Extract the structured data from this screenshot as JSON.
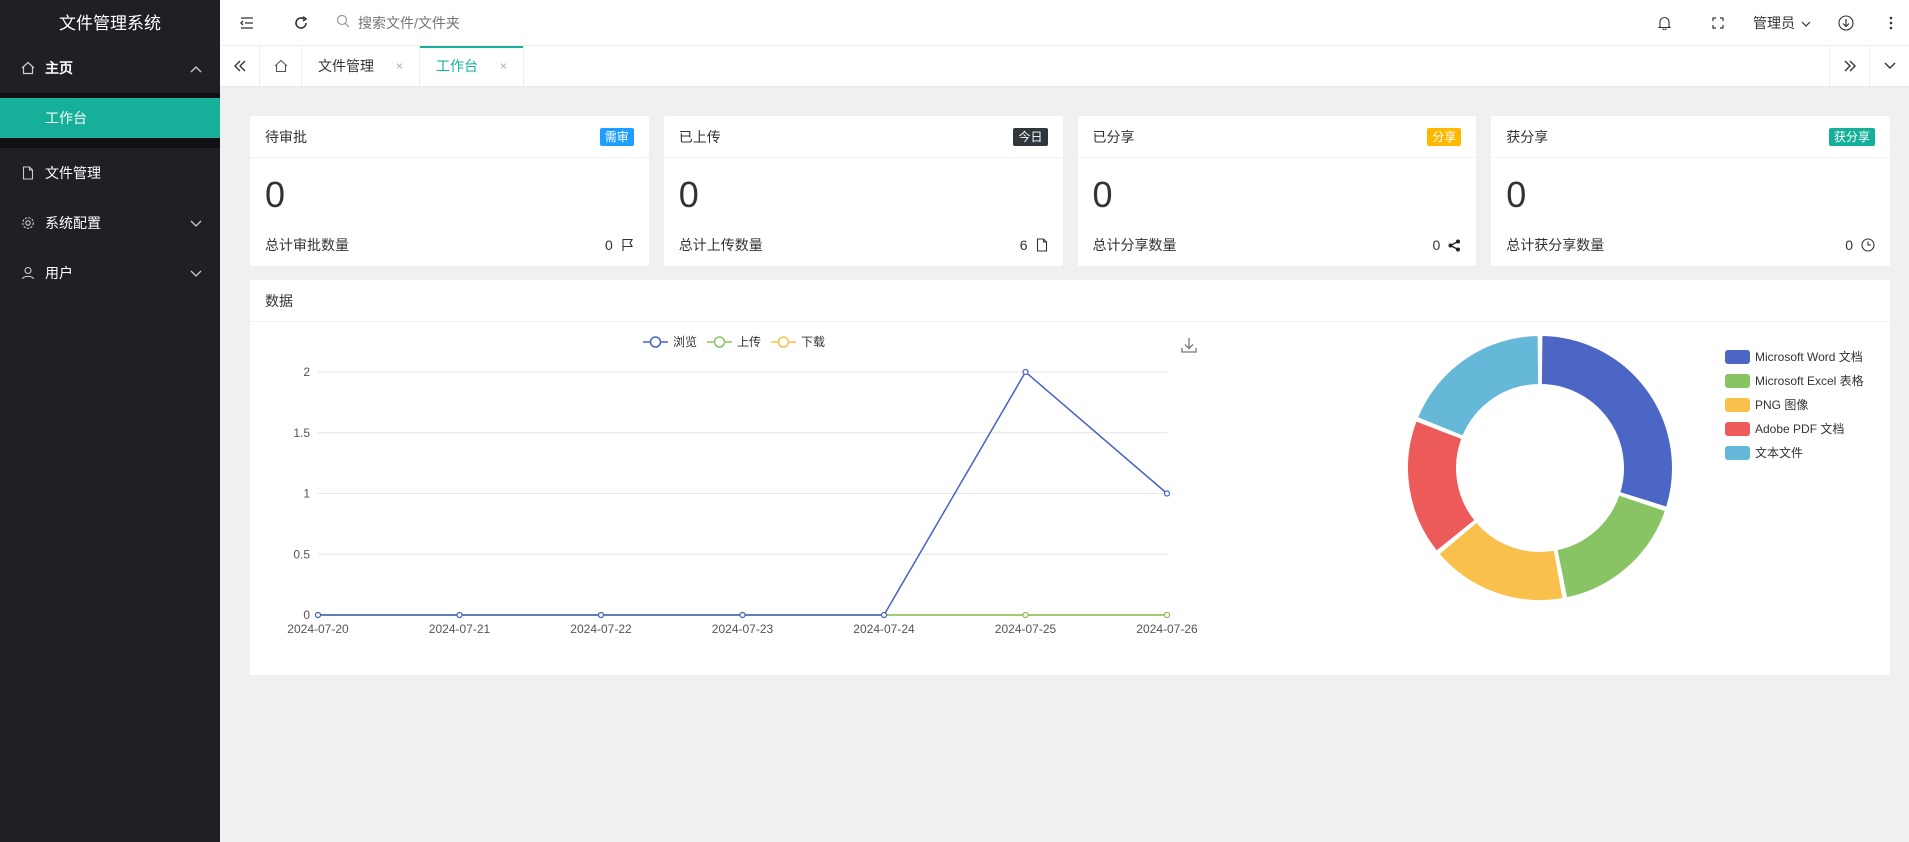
{
  "sidebar": {
    "brand": "文件管理系统",
    "items": [
      {
        "label": "主页",
        "icon": "home-icon",
        "expanded": true
      },
      {
        "label": "工作台",
        "active": true
      },
      {
        "label": "文件管理",
        "icon": "file-icon"
      },
      {
        "label": "系统配置",
        "icon": "gear-icon"
      },
      {
        "label": "用户",
        "icon": "user-icon"
      }
    ]
  },
  "header": {
    "search_placeholder": "搜索文件/文件夹",
    "user": "管理员"
  },
  "tabs": {
    "items": [
      {
        "label": "文件管理",
        "close": "×"
      },
      {
        "label": "工作台",
        "close": "×",
        "active": true
      }
    ]
  },
  "cards": [
    {
      "title": "待审批",
      "badge": "需审",
      "badge_color": "#1e9fff",
      "value": "0",
      "footer_label": "总计审批数量",
      "footer_value": "0",
      "icon": "flag-icon"
    },
    {
      "title": "已上传",
      "badge": "今日",
      "badge_color": "#2f363c",
      "value": "0",
      "footer_label": "总计上传数量",
      "footer_value": "6",
      "icon": "file-icon"
    },
    {
      "title": "已分享",
      "badge": "分享",
      "badge_color": "#ffb800",
      "value": "0",
      "footer_label": "总计分享数量",
      "footer_value": "0",
      "icon": "share-icon"
    },
    {
      "title": "获分享",
      "badge": "获分享",
      "badge_color": "#16b09a",
      "value": "0",
      "footer_label": "总计获分享数量",
      "footer_value": "0",
      "icon": "clock-icon"
    }
  ],
  "panel": {
    "title": "数据"
  },
  "chart_data": [
    {
      "type": "line",
      "x": [
        "2024-07-20",
        "2024-07-21",
        "2024-07-22",
        "2024-07-23",
        "2024-07-24",
        "2024-07-25",
        "2024-07-26"
      ],
      "series": [
        {
          "name": "浏览",
          "color": "#4662c6",
          "values": [
            0,
            0,
            0,
            0,
            0,
            2,
            1
          ]
        },
        {
          "name": "上传",
          "color": "#88c463",
          "values": [
            0,
            0,
            0,
            0,
            0,
            0,
            0
          ]
        },
        {
          "name": "下载",
          "color": "#f9c04b",
          "values": [
            0,
            0,
            0,
            0,
            0,
            0,
            0
          ]
        }
      ],
      "yticks": [
        "0",
        "0.5",
        "1",
        "1.5",
        "2"
      ],
      "ylim": [
        0,
        2
      ],
      "grid": true,
      "legend": "top-center"
    },
    {
      "type": "pie",
      "donut": true,
      "labels": [
        "Microsoft Word 文档",
        "Microsoft Excel 表格",
        "PNG 图像",
        "Adobe PDF 文档",
        "文本文件"
      ],
      "values": [
        30,
        17,
        17,
        17,
        19
      ],
      "colors": [
        "#4b66c4",
        "#88c463",
        "#f9c04b",
        "#ec5a59",
        "#65b8d8"
      ],
      "legend": "top-right"
    }
  ]
}
